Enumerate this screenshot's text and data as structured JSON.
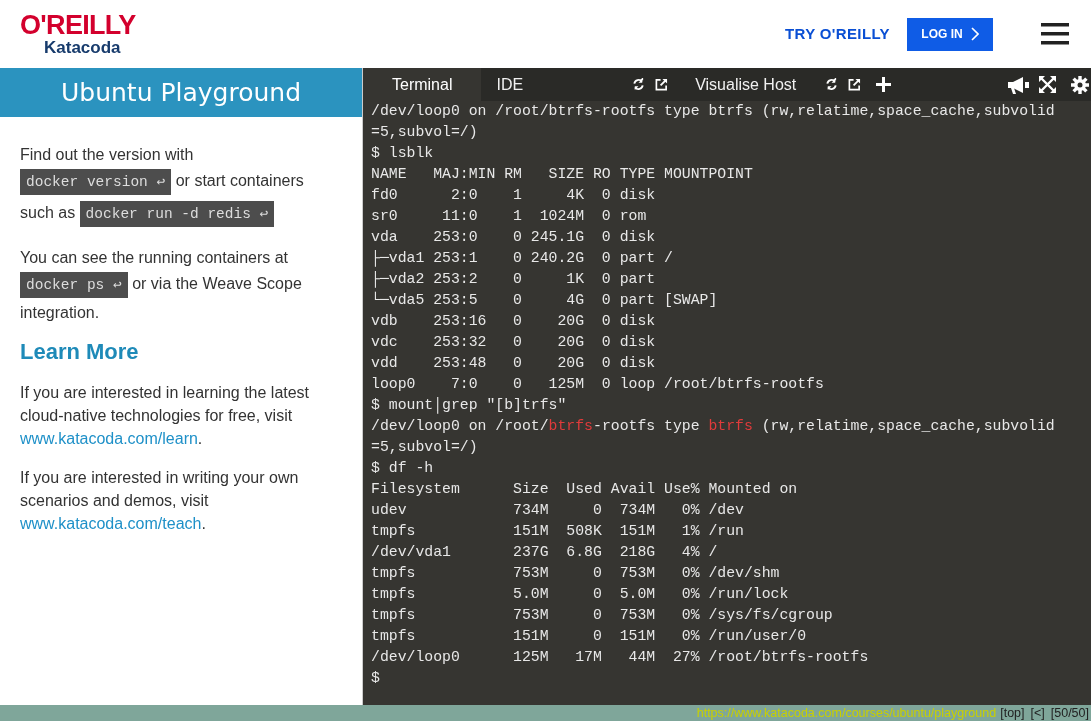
{
  "header": {
    "brand": "O'REILLY",
    "sub_brand": "Katacoda",
    "try_link": "TRY O'REILLY",
    "login_button": "LOG IN"
  },
  "sidebar": {
    "title": "Ubuntu Playground",
    "blocks": [
      {
        "kind": "para",
        "parts": [
          {
            "text": "Find out the version with "
          },
          {
            "code": "docker version ↩"
          },
          {
            "text": " or start containers such as "
          },
          {
            "code": "docker run -d redis ↩"
          }
        ]
      },
      {
        "kind": "para",
        "parts": [
          {
            "text": "You can see the running containers at "
          },
          {
            "code": "docker ps ↩"
          },
          {
            "text": " or via the Weave Scope integration."
          }
        ]
      },
      {
        "kind": "heading",
        "text": "Learn More"
      },
      {
        "kind": "para",
        "parts": [
          {
            "text": "If you are interested in learning the latest cloud-native technologies for free, visit "
          },
          {
            "link": "www.katacoda.com/learn"
          },
          {
            "text": "."
          }
        ]
      },
      {
        "kind": "para",
        "parts": [
          {
            "text": "If you are interested in writing your own scenarios and demos, visit "
          },
          {
            "link": "www.katacoda.com/teach"
          },
          {
            "text": "."
          }
        ]
      }
    ]
  },
  "tabs": [
    {
      "label": "Terminal",
      "selected": true
    },
    {
      "label": "IDE",
      "selected": false
    },
    {
      "label": "Visualise Host",
      "selected": false
    }
  ],
  "terminal": {
    "lines": [
      [
        {
          "text": "/dev/loop0 on /root/btrfs-rootfs type btrfs (rw,relatime,space_cache,subvolid"
        }
      ],
      [
        {
          "text": "=5,subvol=/)"
        }
      ],
      [
        {
          "text": "$ lsblk"
        }
      ],
      [
        {
          "text": "NAME   MAJ:MIN RM   SIZE RO TYPE MOUNTPOINT"
        }
      ],
      [
        {
          "text": "fd0      2:0    1     4K  0 disk"
        }
      ],
      [
        {
          "text": "sr0     11:0    1  1024M  0 rom"
        }
      ],
      [
        {
          "text": "vda    253:0    0 245.1G  0 disk"
        }
      ],
      [
        {
          "text": "├─vda1 253:1    0 240.2G  0 part /"
        }
      ],
      [
        {
          "text": "├─vda2 253:2    0     1K  0 part"
        }
      ],
      [
        {
          "text": "└─vda5 253:5    0     4G  0 part [SWAP]"
        }
      ],
      [
        {
          "text": "vdb    253:16   0    20G  0 disk"
        }
      ],
      [
        {
          "text": "vdc    253:32   0    20G  0 disk"
        }
      ],
      [
        {
          "text": "vdd    253:48   0    20G  0 disk"
        }
      ],
      [
        {
          "text": "loop0    7:0    0   125M  0 loop /root/btrfs-rootfs"
        }
      ],
      [
        {
          "text": "$ mount│grep \"[b]trfs\""
        }
      ],
      [
        {
          "text": "/dev/loop0 on /root/"
        },
        {
          "text": "btrfs",
          "highlight": true
        },
        {
          "text": "-rootfs type "
        },
        {
          "text": "btrfs",
          "highlight": true
        },
        {
          "text": " (rw,relatime,space_cache,subvolid"
        }
      ],
      [
        {
          "text": "=5,subvol=/)"
        }
      ],
      [
        {
          "text": "$ df -h"
        }
      ],
      [
        {
          "text": "Filesystem      Size  Used Avail Use% Mounted on"
        }
      ],
      [
        {
          "text": "udev            734M     0  734M   0% /dev"
        }
      ],
      [
        {
          "text": "tmpfs           151M  508K  151M   1% /run"
        }
      ],
      [
        {
          "text": "/dev/vda1       237G  6.8G  218G   4% /"
        }
      ],
      [
        {
          "text": "tmpfs           753M     0  753M   0% /dev/shm"
        }
      ],
      [
        {
          "text": "tmpfs           5.0M     0  5.0M   0% /run/lock"
        }
      ],
      [
        {
          "text": "tmpfs           753M     0  753M   0% /sys/fs/cgroup"
        }
      ],
      [
        {
          "text": "tmpfs           151M     0  151M   0% /run/user/0"
        }
      ],
      [
        {
          "text": "/dev/loop0      125M   17M   44M  27% /root/btrfs-rootfs"
        }
      ],
      [
        {
          "text": "$"
        }
      ]
    ]
  },
  "status_bar": {
    "url": "https://www.katacoda.com/courses/ubuntu/playground",
    "controls": [
      "[top]",
      "[<]",
      "[50/50]"
    ]
  }
}
